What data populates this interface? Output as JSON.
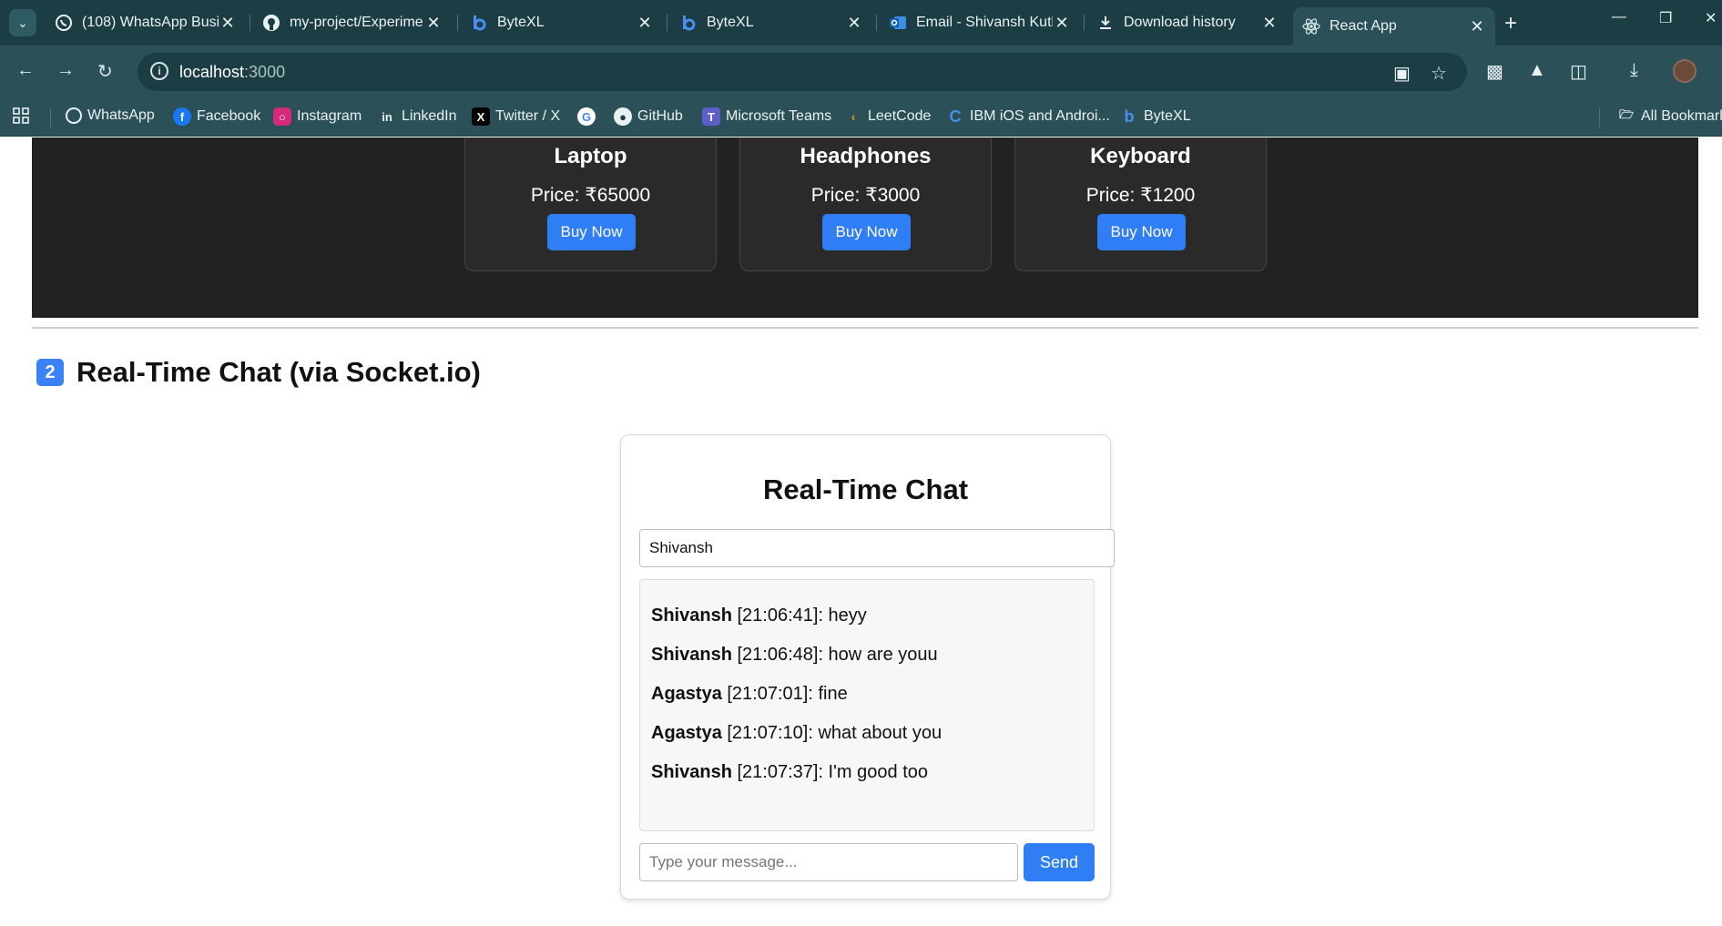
{
  "browser": {
    "tabs": [
      {
        "title": "(108) WhatsApp Busi",
        "icon": "whatsapp-icon",
        "active": false
      },
      {
        "title": "my-project/Experime",
        "icon": "github-icon",
        "active": false
      },
      {
        "title": "ByteXL",
        "icon": "bytexl-icon",
        "active": false
      },
      {
        "title": "ByteXL",
        "icon": "bytexl-icon",
        "active": false
      },
      {
        "title": "Email - Shivansh Kutl",
        "icon": "outlook-icon",
        "active": false
      },
      {
        "title": "Download history",
        "icon": "download-icon",
        "active": false
      },
      {
        "title": "React App",
        "icon": "react-icon",
        "active": true
      }
    ],
    "address": {
      "host": "localhost",
      "port": ":3000"
    },
    "bookmarks": [
      {
        "label": "WhatsApp",
        "icon": "whatsapp-icon"
      },
      {
        "label": "Facebook",
        "icon": "facebook-icon"
      },
      {
        "label": "Instagram",
        "icon": "instagram-icon"
      },
      {
        "label": "LinkedIn",
        "icon": "linkedin-icon"
      },
      {
        "label": "Twitter / X",
        "icon": "x-icon"
      },
      {
        "label": "",
        "icon": "google-icon"
      },
      {
        "label": "GitHub",
        "icon": "github-icon"
      },
      {
        "label": "Microsoft Teams",
        "icon": "teams-icon"
      },
      {
        "label": "LeetCode",
        "icon": "leetcode-icon"
      },
      {
        "label": "IBM iOS and Androi...",
        "icon": "coursera-icon"
      },
      {
        "label": "ByteXL",
        "icon": "bytexl-icon"
      }
    ],
    "all_bookmarks_label": "All Bookmarks"
  },
  "products": [
    {
      "name": "Laptop",
      "price": "Price: ₹65000",
      "button": "Buy Now"
    },
    {
      "name": "Headphones",
      "price": "Price: ₹3000",
      "button": "Buy Now"
    },
    {
      "name": "Keyboard",
      "price": "Price: ₹1200",
      "button": "Buy Now"
    }
  ],
  "section": {
    "number": "2",
    "title": "Real-Time Chat (via Socket.io)"
  },
  "chat": {
    "title": "Real-Time Chat",
    "name_value": "Shivansh",
    "messages": [
      {
        "user": "Shivansh",
        "rest": " [21:06:41]: heyy"
      },
      {
        "user": "Shivansh",
        "rest": " [21:06:48]: how are youu"
      },
      {
        "user": "Agastya",
        "rest": " [21:07:01]: fine"
      },
      {
        "user": "Agastya",
        "rest": " [21:07:10]: what about you"
      },
      {
        "user": "Shivansh",
        "rest": " [21:07:37]: I'm good too"
      }
    ],
    "message_placeholder": "Type your message...",
    "send_label": "Send"
  },
  "colors": {
    "accent": "#2f7ef5",
    "chrome_dark": "#1c3d44",
    "chrome": "#2b5058",
    "products_bg": "#222222"
  }
}
